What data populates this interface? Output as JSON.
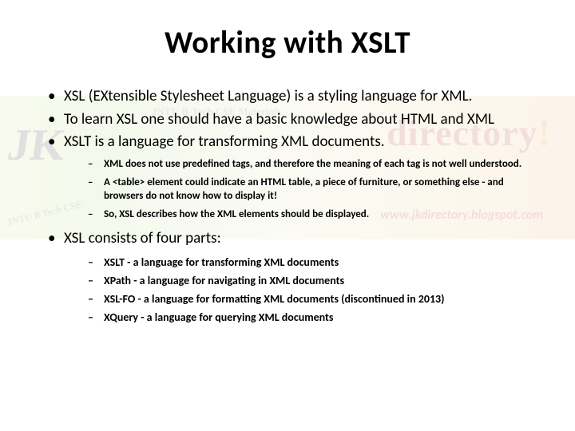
{
  "title": "Working with XSLT",
  "bullets": [
    "XSL (EXtensible Stylesheet Language) is a styling language for XML.",
    "To learn XSL one should have a basic knowledge about HTML and XML",
    "XSLT is a language for transforming XML documents."
  ],
  "subBullets1": [
    "XML does not use predefined tags, and therefore the meaning of each tag is not well understood.",
    "A <table> element could indicate an HTML table, a piece of furniture, or something else - and browsers do not know how to display it!",
    "So, XSL describes how the XML elements should be displayed."
  ],
  "bullet4": "XSL consists of four parts:",
  "subBullets2": [
    "XSLT - a language for transforming XML documents",
    "XPath - a language for navigating in XML documents",
    "XSL-FO - a language for formatting XML documents (discontinued in 2013)",
    "XQuery - a language for querying XML documents"
  ],
  "watermark": {
    "left": "JK",
    "mid": "JNTU B-Tech CSE Materials",
    "right": "directory",
    "url": "www.jkdirectory.blogspot.com",
    "btech": "JNTU B Tech CSE"
  }
}
